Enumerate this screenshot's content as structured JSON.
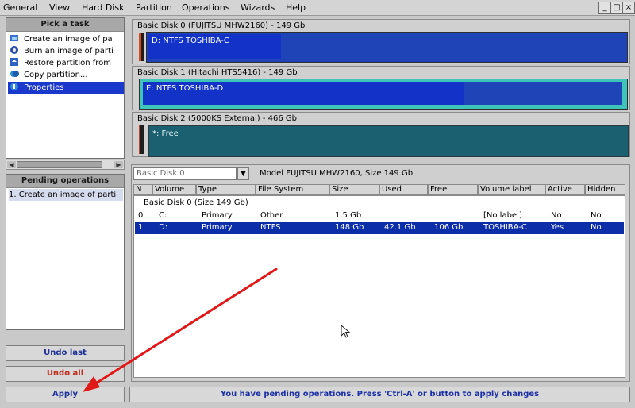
{
  "menubar": {
    "items": [
      "General",
      "View",
      "Hard Disk",
      "Partition",
      "Operations",
      "Wizards",
      "Help"
    ]
  },
  "window_controls": {
    "minimize": "_",
    "maximize": "□",
    "close": "×"
  },
  "tasks": {
    "title": "Pick a task",
    "items": [
      {
        "label": "Create an image of pa",
        "icon": "disk-image-icon"
      },
      {
        "label": "Burn an image of parti",
        "icon": "burn-icon"
      },
      {
        "label": "Restore partition from",
        "icon": "restore-icon"
      },
      {
        "label": "Copy partition...",
        "icon": "copy-partition-icon"
      },
      {
        "label": "Properties",
        "icon": "properties-icon",
        "selected": true
      }
    ]
  },
  "pending": {
    "title": "Pending operations",
    "items": [
      "1. Create an image of parti"
    ]
  },
  "buttons": {
    "undo_last": "Undo last",
    "undo_all": "Undo all",
    "apply": "Apply"
  },
  "disks": [
    {
      "title": "Basic Disk 0 (FUJITSU MHW2160) - 149 Gb",
      "partition_label": "D: NTFS TOSHIBA-C",
      "used_fraction": 0.28
    },
    {
      "title": "Basic Disk 1 (Hitachi HTS5416) - 149 Gb",
      "partition_label": "E: NTFS TOSHIBA-D",
      "used_fraction": 0.67
    },
    {
      "title": "Basic Disk 2 (5000KS External) - 466 Gb",
      "partition_label": "*: Free",
      "used_fraction": 0
    }
  ],
  "disk_selector": {
    "value": "Basic Disk 0",
    "model_text": "Model FUJITSU MHW2160, Size 149 Gb"
  },
  "table": {
    "columns": [
      "N",
      "Volume",
      "Type",
      "File System",
      "Size",
      "Used",
      "Free",
      "Volume label",
      "Active",
      "Hidden"
    ],
    "group_label": "Basic Disk 0 (Size 149 Gb)",
    "rows": [
      {
        "cells": [
          "0",
          "C:",
          "Primary",
          "Other",
          "1.5 Gb",
          "",
          "",
          "[No label]",
          "No",
          "No"
        ],
        "selected": false
      },
      {
        "cells": [
          "1",
          "D:",
          "Primary",
          "NTFS",
          "148 Gb",
          "42.1 Gb",
          "106 Gb",
          "TOSHIBA-C",
          "Yes",
          "No"
        ],
        "selected": true
      }
    ]
  },
  "status": {
    "message": "You have pending operations. Press 'Ctrl-A' or button to apply changes"
  },
  "colors": {
    "accent_blue": "#1b38cc",
    "selection": "#0c2ea8",
    "undo_all_red": "#c0281a",
    "status_blue": "#1b2fa8",
    "arrow_red": "#e01818"
  }
}
